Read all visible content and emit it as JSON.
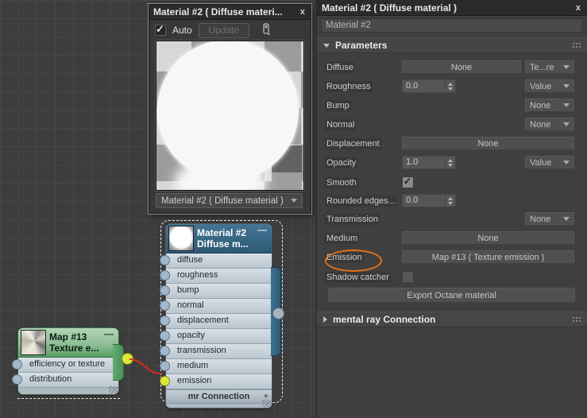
{
  "colors": {
    "annotation_orange": "#E4731D",
    "wire_red": "#E2271C",
    "socket_yellow": "#DCE93B",
    "node_blue": "#3F718F",
    "node_green": "#63AC72"
  },
  "preview_window": {
    "title": "Material #2 ( Diffuse materi...",
    "close_label": "x",
    "auto_label": "Auto",
    "update_label": "Update",
    "selector_label": "Material #2 ( Diffuse material )"
  },
  "graph": {
    "material_node": {
      "title": "Material #2",
      "subtitle": "Diffuse m...",
      "collapse_glyph": "—",
      "slots": [
        "diffuse",
        "roughness",
        "bump",
        "normal",
        "displacement",
        "opacity",
        "transmission",
        "medium",
        "emission"
      ],
      "footer_label": "mr Connection",
      "footer_expand_glyph": "+"
    },
    "map_node": {
      "title": "Map #13",
      "subtitle": "Texture e...",
      "collapse_glyph": "—",
      "slots": [
        "efficiency or texture",
        "distribution"
      ]
    }
  },
  "panel": {
    "title": "Material #2 ( Diffuse material )",
    "close_label": "x",
    "material_name": "Material #2",
    "parameters_rollout": "Parameters",
    "mental_ray_rollout": "mental ray Connection",
    "params": {
      "diffuse": {
        "label": "Diffuse",
        "button": "None",
        "type": "Te...re"
      },
      "roughness": {
        "label": "Roughness",
        "value": "0.0",
        "type": "Value"
      },
      "bump": {
        "label": "Bump",
        "type": "None"
      },
      "normal": {
        "label": "Normal",
        "type": "None"
      },
      "displacement": {
        "label": "Displacement",
        "button": "None"
      },
      "opacity": {
        "label": "Opacity",
        "value": "1.0",
        "type": "Value"
      },
      "smooth": {
        "label": "Smooth",
        "checked": true
      },
      "rounded_edges": {
        "label": "Rounded edges...",
        "value": "0.0"
      },
      "transmission": {
        "label": "Transmission",
        "type": "None"
      },
      "medium": {
        "label": "Medium",
        "button": "None"
      },
      "emission": {
        "label": "Emission",
        "button": "Map #13 ( Texture emission )"
      },
      "shadow_catcher": {
        "label": "Shadow catcher",
        "checked": false
      }
    },
    "export_button": "Export Octane material"
  }
}
